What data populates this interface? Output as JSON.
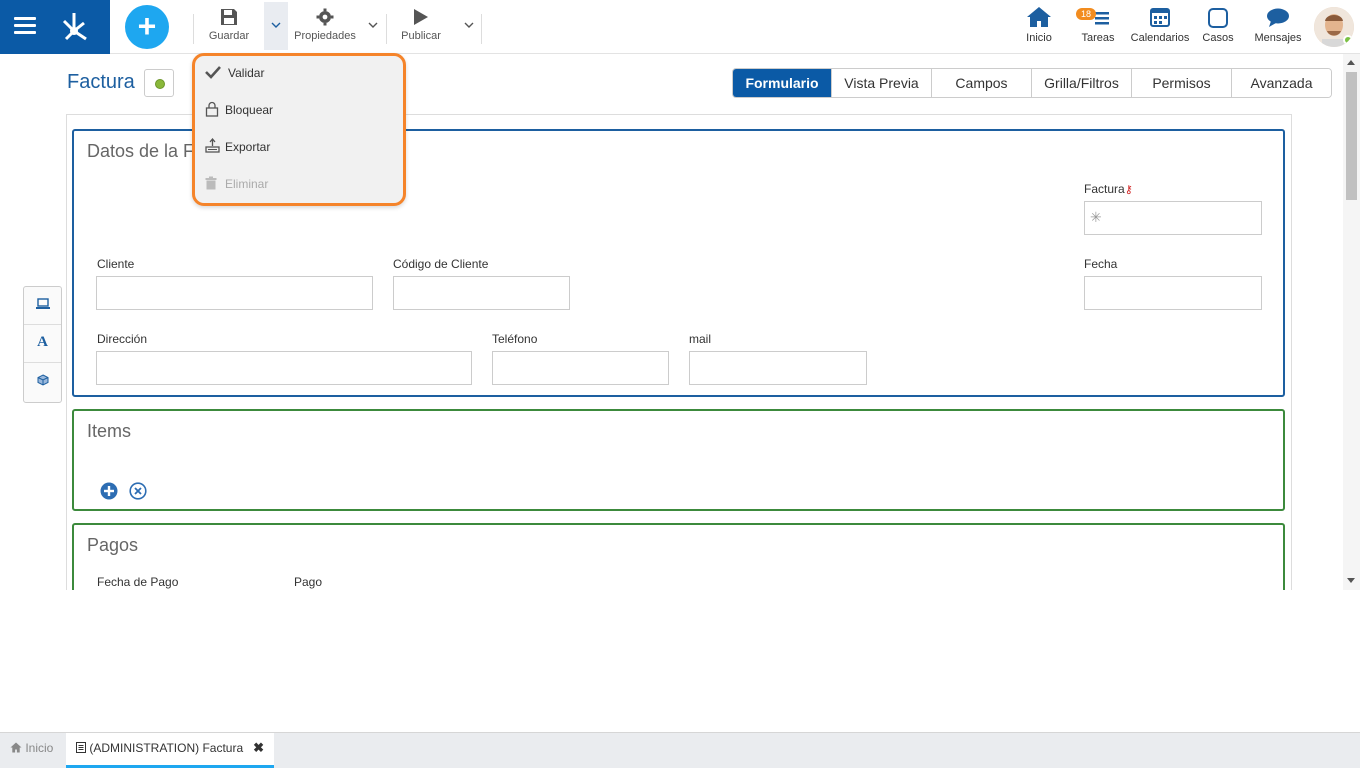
{
  "toolbar": {
    "save_label": "Guardar",
    "properties_label": "Propiedades",
    "publish_label": "Publicar"
  },
  "nav": {
    "home_label": "Inicio",
    "tasks_label": "Tareas",
    "tasks_badge": "18",
    "calendars_label": "Calendarios",
    "cases_label": "Casos",
    "messages_label": "Mensajes"
  },
  "page": {
    "title": "Factura"
  },
  "tabs": [
    {
      "label": "Formulario",
      "active": true
    },
    {
      "label": "Vista Previa"
    },
    {
      "label": "Campos"
    },
    {
      "label": "Grilla/Filtros"
    },
    {
      "label": "Permisos"
    },
    {
      "label": "Avanzada"
    }
  ],
  "dropdown": {
    "items": [
      {
        "label": "Validar",
        "icon": "check-icon"
      },
      {
        "label": "Bloquear",
        "icon": "lock-icon"
      },
      {
        "label": "Exportar",
        "icon": "export-icon"
      },
      {
        "label": "Eliminar",
        "icon": "trash-icon",
        "disabled": true
      }
    ]
  },
  "sections": {
    "datos": {
      "title": "Datos de la F",
      "fields": {
        "factura": "Factura",
        "cliente": "Cliente",
        "codigo": "Código de Cliente",
        "fecha": "Fecha",
        "direccion": "Dirección",
        "telefono": "Teléfono",
        "mail": "mail"
      },
      "factura_value": "✳"
    },
    "items": {
      "title": "Items"
    },
    "pagos": {
      "title": "Pagos",
      "fields": {
        "fecha_pago": "Fecha de Pago",
        "pago": "Pago"
      }
    }
  },
  "bottom_tabs": {
    "home": "Inicio",
    "doc": "(ADMINISTRATION) Factura",
    "close": "✖"
  },
  "colors": {
    "brand": "#0b5aa6",
    "accent": "#1ea7f0",
    "highlight": "#f5842a",
    "section_green": "#3c8a3c"
  }
}
